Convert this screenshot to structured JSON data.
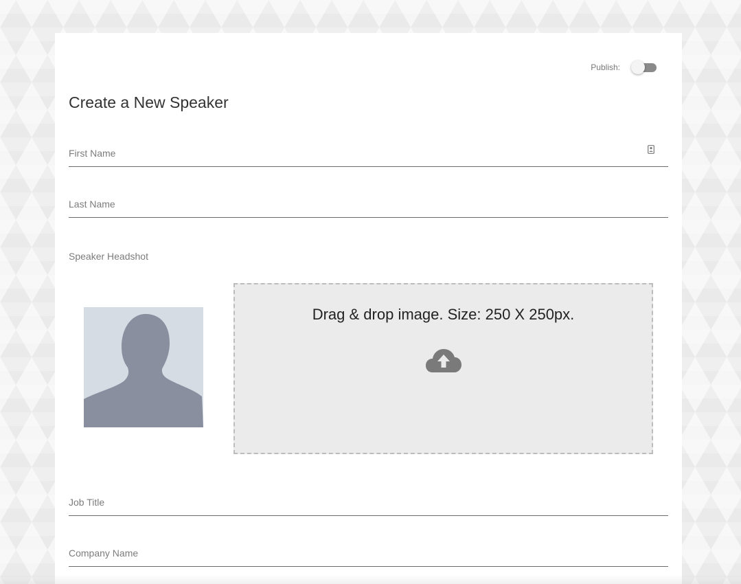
{
  "publish": {
    "label": "Publish:",
    "enabled": false
  },
  "page_title": "Create a New Speaker",
  "fields": {
    "first_name": {
      "placeholder": "First Name",
      "value": "",
      "icon": "contact-card-icon"
    },
    "last_name": {
      "placeholder": "Last Name",
      "value": ""
    },
    "job_title": {
      "placeholder": "Job Title",
      "value": ""
    },
    "company_name": {
      "placeholder": "Company Name",
      "value": ""
    }
  },
  "headshot": {
    "label": "Speaker Headshot",
    "placeholder_icon": "person-silhouette-icon",
    "dropzone_text": "Drag & drop image. Size: 250 X 250px.",
    "upload_icon": "cloud-upload-icon"
  },
  "colors": {
    "underline": "#6a6a6a",
    "toggle_track": "#8a8a8a",
    "headshot_bg": "#d6dce3",
    "silhouette": "#8a8fa0",
    "dropzone_bg": "#ebebeb",
    "upload_icon": "#7a7a7a"
  }
}
